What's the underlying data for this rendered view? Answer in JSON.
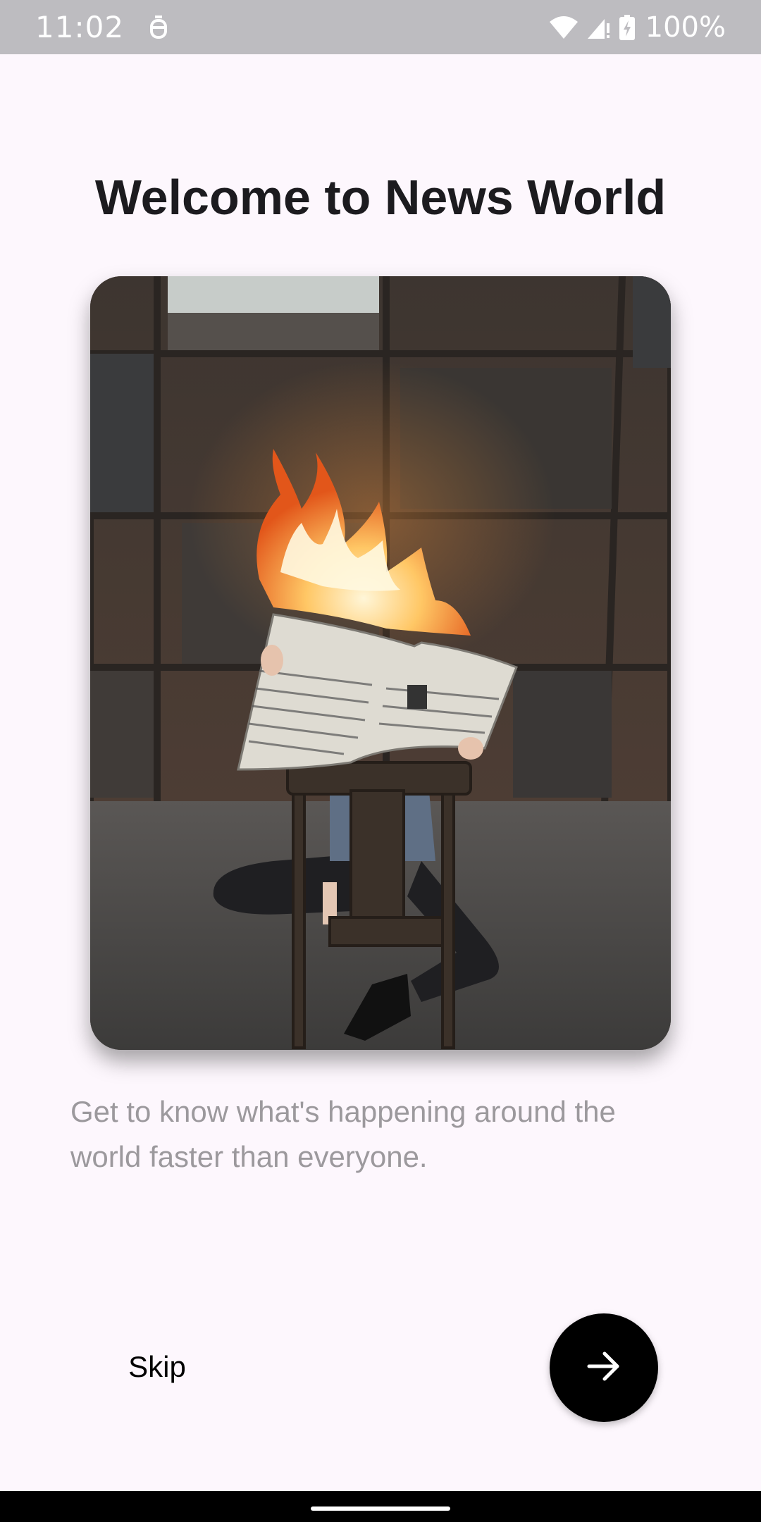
{
  "status_bar": {
    "time": "11:02",
    "battery_text": "100%",
    "icons": [
      "notification-app-icon",
      "wifi-icon",
      "signal-icon",
      "battery-charging-icon"
    ]
  },
  "onboarding": {
    "title": "Welcome to News World",
    "hero_image_icon": "burning-newspaper-photo",
    "description": "Get to know what's happening around the world faster than everyone.",
    "skip_label": "Skip",
    "next_icon": "arrow-right-icon"
  },
  "colors": {
    "background": "#fdf7fd",
    "title": "#1c1b1f",
    "description": "#9c999d",
    "next_button": "#000000",
    "status_bar": "#bdbcc0"
  }
}
